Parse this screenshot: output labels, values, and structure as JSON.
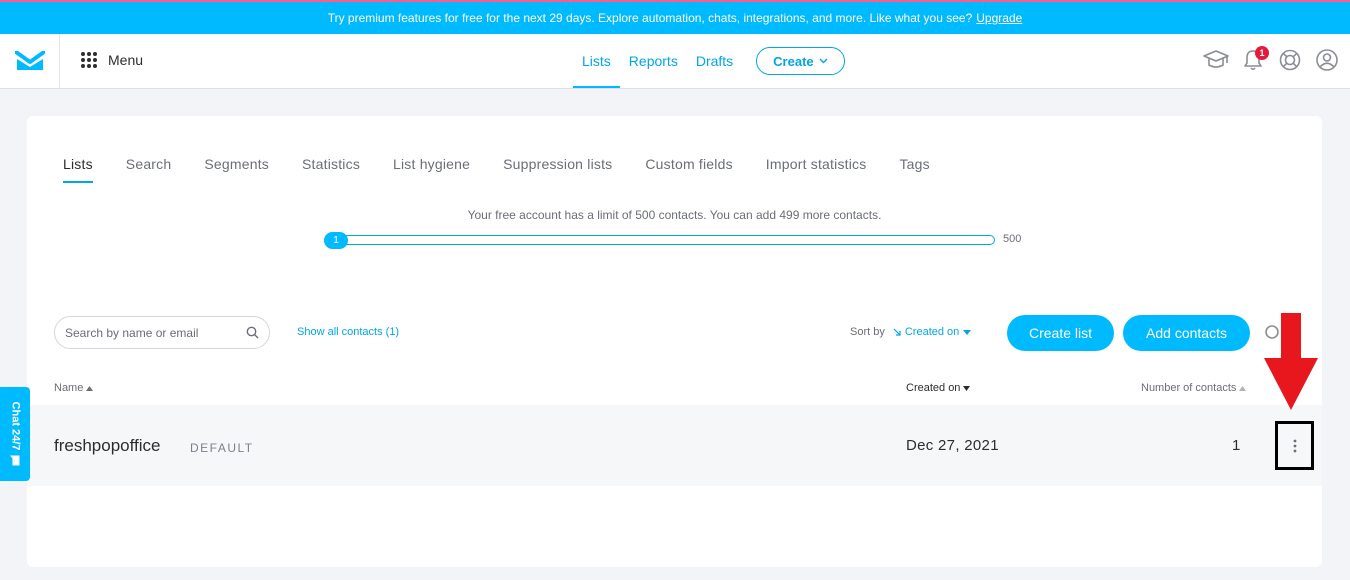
{
  "promo": {
    "text": "Try premium features for free for the next 29 days. Explore automation, chats, integrations, and more. Like what you see?",
    "link": "Upgrade"
  },
  "header": {
    "logo_icon": "envelope-icon",
    "menu_label": "Menu",
    "nav": [
      {
        "label": "Lists",
        "active": true
      },
      {
        "label": "Reports",
        "active": false
      },
      {
        "label": "Drafts",
        "active": false
      }
    ],
    "create_label": "Create",
    "notification_count": "1",
    "icons": [
      "graduation-cap-icon",
      "bell-icon",
      "lifebuoy-icon",
      "user-icon"
    ]
  },
  "tabs": [
    {
      "label": "Lists",
      "active": true
    },
    {
      "label": "Search"
    },
    {
      "label": "Segments"
    },
    {
      "label": "Statistics"
    },
    {
      "label": "List hygiene"
    },
    {
      "label": "Suppression lists"
    },
    {
      "label": "Custom fields"
    },
    {
      "label": "Import statistics"
    },
    {
      "label": "Tags"
    }
  ],
  "limit": {
    "text": "Your free account has a limit of 500 contacts. You can add 499 more contacts.",
    "current": "1",
    "max": "500"
  },
  "toolbar": {
    "search_placeholder": "Search by name or email",
    "show_all": "Show all contacts (1)",
    "sort_label": "Sort by",
    "sort_value": "Created on",
    "create_list": "Create list",
    "add_contacts": "Add contacts"
  },
  "table": {
    "columns": [
      "Name",
      "Created on",
      "Number of contacts"
    ],
    "rows": [
      {
        "name": "freshpopoffice",
        "tag": "DEFAULT",
        "created_on": "Dec 27, 2021",
        "count": "1"
      }
    ]
  },
  "chat_label": "Chat 24/7",
  "colors": {
    "accent": "#00baff",
    "link": "#00a6e6",
    "badge": "#e31c3d",
    "annotation_arrow": "#e8161d"
  }
}
